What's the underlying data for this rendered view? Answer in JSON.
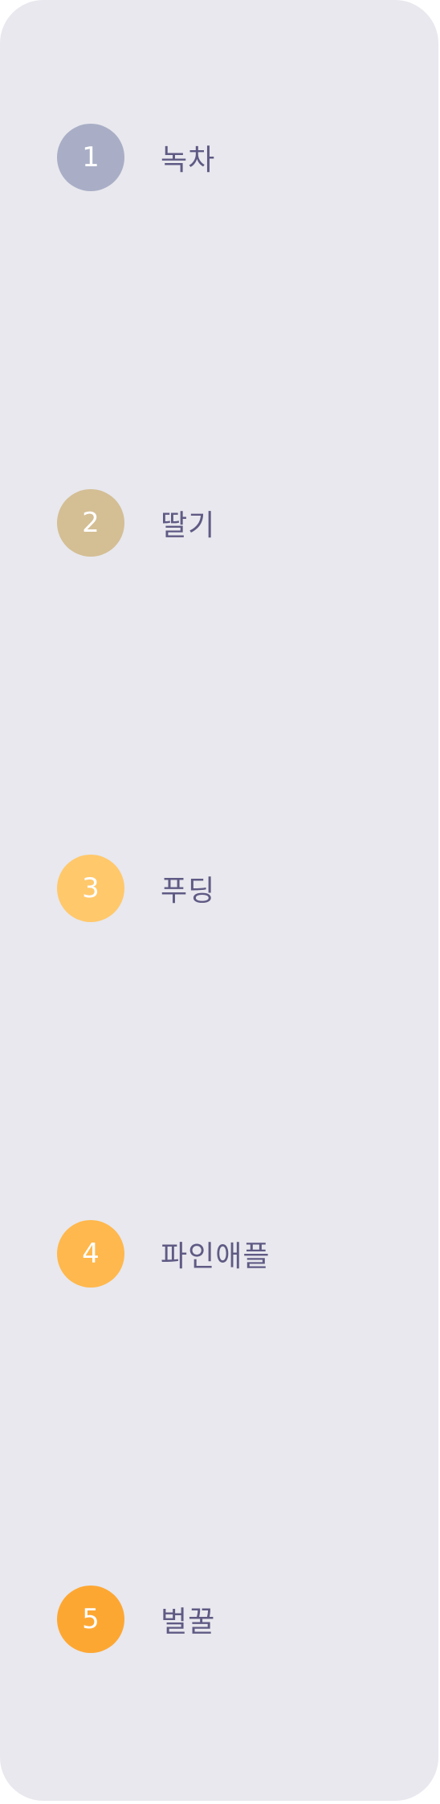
{
  "steps": [
    {
      "number": "1",
      "label": "녹차",
      "color": "#a9aec6"
    },
    {
      "number": "2",
      "label": "딸기",
      "color": "#d4be94"
    },
    {
      "number": "3",
      "label": "푸딩",
      "color": "#ffc86b"
    },
    {
      "number": "4",
      "label": "파인애플",
      "color": "#ffb84d"
    },
    {
      "number": "5",
      "label": "벌꿀",
      "color": "#fda733"
    }
  ]
}
